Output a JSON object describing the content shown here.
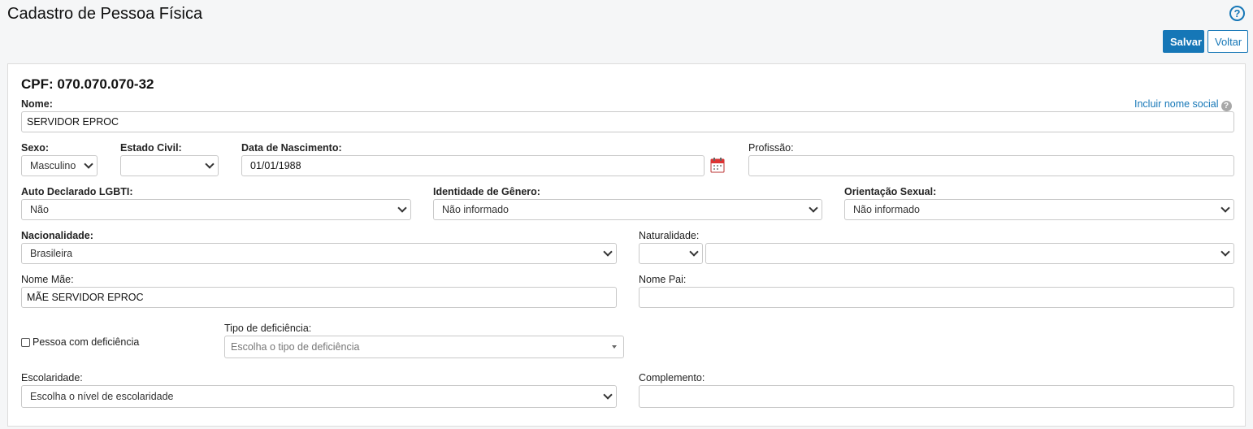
{
  "header": {
    "title": "Cadastro de Pessoa Física",
    "help_icon": "help-circle-icon",
    "save_label": "Salvar",
    "back_label": "Voltar"
  },
  "form": {
    "cpf": "CPF: 070.070.070-32",
    "nome": {
      "label": "Nome:",
      "value": "SERVIDOR EPROC"
    },
    "incluir_nome_social": "Incluir nome social",
    "sexo": {
      "label": "Sexo:",
      "value": "Masculino"
    },
    "estado_civil": {
      "label": "Estado Civil:",
      "value": ""
    },
    "data_nascimento": {
      "label": "Data de Nascimento:",
      "value": "01/01/1988",
      "icon": "calendar-icon"
    },
    "profissao": {
      "label": "Profissão:",
      "value": ""
    },
    "lgbti": {
      "label": "Auto Declarado LGBTI:",
      "value": "Não"
    },
    "identidade_genero": {
      "label": "Identidade de Gênero:",
      "value": "Não informado"
    },
    "orientacao_sexual": {
      "label": "Orientação Sexual:",
      "value": "Não informado"
    },
    "nacionalidade": {
      "label": "Nacionalidade:",
      "value": "Brasileira"
    },
    "naturalidade": {
      "label": "Naturalidade:",
      "uf_value": "",
      "cidade_value": ""
    },
    "nome_mae": {
      "label": "Nome Mãe:",
      "value": "MÃE SERVIDOR EPROC"
    },
    "nome_pai": {
      "label": "Nome Pai:",
      "value": ""
    },
    "pessoa_deficiencia": {
      "label": "Pessoa com deficiência",
      "checked": false
    },
    "tipo_deficiencia": {
      "label": "Tipo de deficiência:",
      "placeholder": "Escolha o tipo de deficiência"
    },
    "escolaridade": {
      "label": "Escolaridade:",
      "value": "Escolha o nível de escolaridade"
    },
    "complemento": {
      "label": "Complemento:",
      "value": ""
    }
  },
  "colors": {
    "accent": "#1677b7",
    "panel_bg": "#ffffff",
    "page_bg": "#f5f6f7"
  }
}
